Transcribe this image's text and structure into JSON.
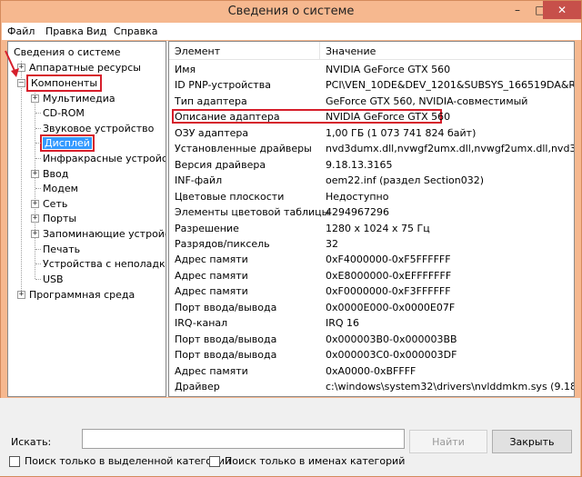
{
  "window": {
    "title": "Сведения о системе"
  },
  "menu": [
    "Файл",
    "Правка",
    "Вид",
    "Справка"
  ],
  "tree": {
    "root": "Сведения о системе",
    "hardware": "Аппаратные ресурсы",
    "components": "Компоненты",
    "children": [
      {
        "label": "Мультимедиа",
        "expandable": true
      },
      {
        "label": "CD-ROM",
        "expandable": false
      },
      {
        "label": "Звуковое устройство",
        "expandable": false
      },
      {
        "label": "Дисплей",
        "expandable": false,
        "selected": true
      },
      {
        "label": "Инфракрасные устройства",
        "expandable": false
      },
      {
        "label": "Ввод",
        "expandable": true
      },
      {
        "label": "Модем",
        "expandable": false
      },
      {
        "label": "Сеть",
        "expandable": true
      },
      {
        "label": "Порты",
        "expandable": true
      },
      {
        "label": "Запоминающие устройства",
        "expandable": true
      },
      {
        "label": "Печать",
        "expandable": false
      },
      {
        "label": "Устройства с неполадками",
        "expandable": false
      },
      {
        "label": "USB",
        "expandable": false
      }
    ],
    "software": "Программная среда"
  },
  "details": {
    "col_element": "Элемент",
    "col_value": "Значение",
    "rows": [
      {
        "k": "Имя",
        "v": "NVIDIA GeForce GTX 560"
      },
      {
        "k": "ID PNP-устройства",
        "v": "PCI\\VEN_10DE&DEV_1201&SUBSYS_166519DA&REV_A1\\"
      },
      {
        "k": "Тип адаптера",
        "v": "GeForce GTX 560, NVIDIA-совместимый"
      },
      {
        "k": "Описание адаптера",
        "v": "NVIDIA GeForce GTX 560"
      },
      {
        "k": "ОЗУ адаптера",
        "v": "1,00 ГБ (1 073 741 824 байт)"
      },
      {
        "k": "Установленные драйверы",
        "v": "nvd3dumx.dll,nvwgf2umx.dll,nvwgf2umx.dll,nvd3dum,nvw"
      },
      {
        "k": "Версия драйвера",
        "v": "9.18.13.3165"
      },
      {
        "k": "INF-файл",
        "v": "oem22.inf (раздел Section032)"
      },
      {
        "k": "Цветовые плоскости",
        "v": "Недоступно"
      },
      {
        "k": "Элементы цветовой таблицы",
        "v": "4294967296"
      },
      {
        "k": "Разрешение",
        "v": "1280 x 1024 x 75 Гц"
      },
      {
        "k": "Разрядов/пиксель",
        "v": "32"
      },
      {
        "k": "Адрес памяти",
        "v": "0xF4000000-0xF5FFFFFF"
      },
      {
        "k": "Адрес памяти",
        "v": "0xE8000000-0xEFFFFFFF"
      },
      {
        "k": "Адрес памяти",
        "v": "0xF0000000-0xF3FFFFFF"
      },
      {
        "k": "Порт ввода/вывода",
        "v": "0x0000E000-0x0000E07F"
      },
      {
        "k": "IRQ-канал",
        "v": "IRQ 16"
      },
      {
        "k": "Порт ввода/вывода",
        "v": "0x000003B0-0x000003BB"
      },
      {
        "k": "Порт ввода/вывода",
        "v": "0x000003C0-0x000003DF"
      },
      {
        "k": "Адрес памяти",
        "v": "0xA0000-0xBFFFF"
      },
      {
        "k": "Драйвер",
        "v": "c:\\windows\\system32\\drivers\\nvlddmkm.sys (9.18.13.316"
      }
    ]
  },
  "search": {
    "label": "Искать:",
    "value": "",
    "find_button": "Найти",
    "close_button": "Закрыть",
    "chk_selected": "Поиск только в выделенной категории",
    "chk_names": "Поиск только в именах категорий"
  }
}
